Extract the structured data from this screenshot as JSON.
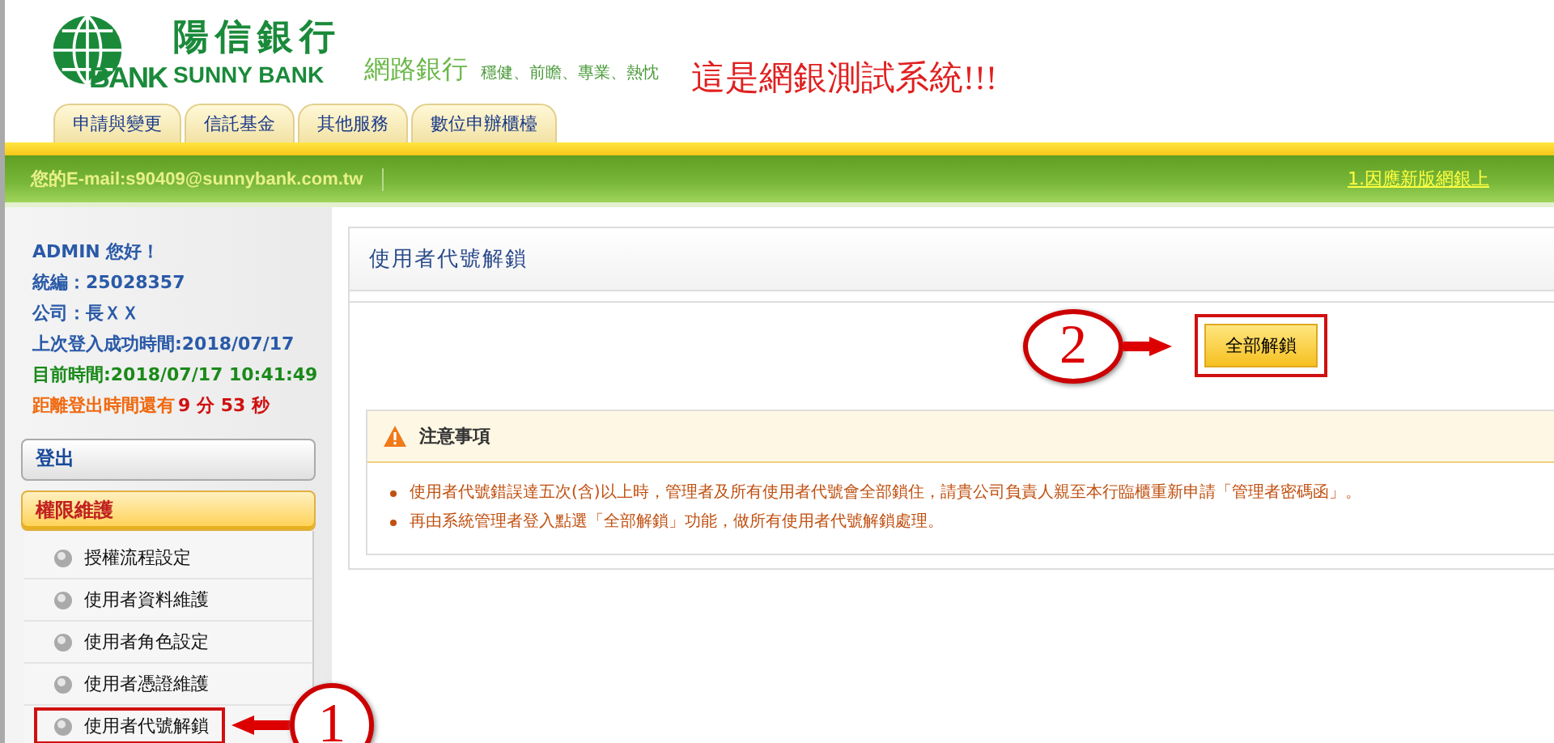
{
  "header": {
    "logo_text": "BANK",
    "bank_name": "陽信銀行",
    "bank_name_en": "SUNNY BANK",
    "product": "網路銀行",
    "slogan": "穩健、前瞻、專業、熱忱",
    "notice": "這是網銀測試系統!!!"
  },
  "tabs": [
    {
      "label": "申請與變更",
      "selected": false
    },
    {
      "label": "信託基金",
      "selected": false
    },
    {
      "label": "其他服務",
      "selected": false
    },
    {
      "label": "數位申辦櫃檯",
      "selected": false
    }
  ],
  "info_bar": {
    "email": "您的E-mail:s90409@sunnybank.com.tw",
    "marquee": "1.因應新版網銀上"
  },
  "sidebar": {
    "greeting": "ADMIN 您好！",
    "tax_id": "統編：25028357",
    "company": "公司：長ＸＸ",
    "last_login": "上次登入成功時間:2018/07/17",
    "now": "目前時間:2018/07/17 10:41:49",
    "timeout_label": "距離登出時間還有",
    "timeout_value": "9 分 53 秒",
    "logout": "登出",
    "section": {
      "label": "權限維護",
      "expanded": true
    },
    "items": [
      {
        "label": "授權流程設定",
        "highlighted": false
      },
      {
        "label": "使用者資料維護",
        "highlighted": false
      },
      {
        "label": "使用者角色設定",
        "highlighted": false
      },
      {
        "label": "使用者憑證維護",
        "highlighted": false
      },
      {
        "label": "使用者代號解鎖",
        "highlighted": true
      }
    ]
  },
  "panel": {
    "title": "使用者代號解鎖",
    "button": {
      "label": "全部解鎖",
      "highlighted": true
    },
    "notice_title": "注意事項",
    "notes": [
      "使用者代號錯誤達五次(含)以上時，管理者及所有使用者代號會全部鎖住，請貴公司負責人親至本行臨櫃重新申請「管理者密碼函」。",
      "再由系統管理者登入點選「全部解鎖」功能，做所有使用者代號解鎖處理。"
    ]
  },
  "callouts": [
    {
      "number": "2"
    },
    {
      "number": "1"
    }
  ]
}
